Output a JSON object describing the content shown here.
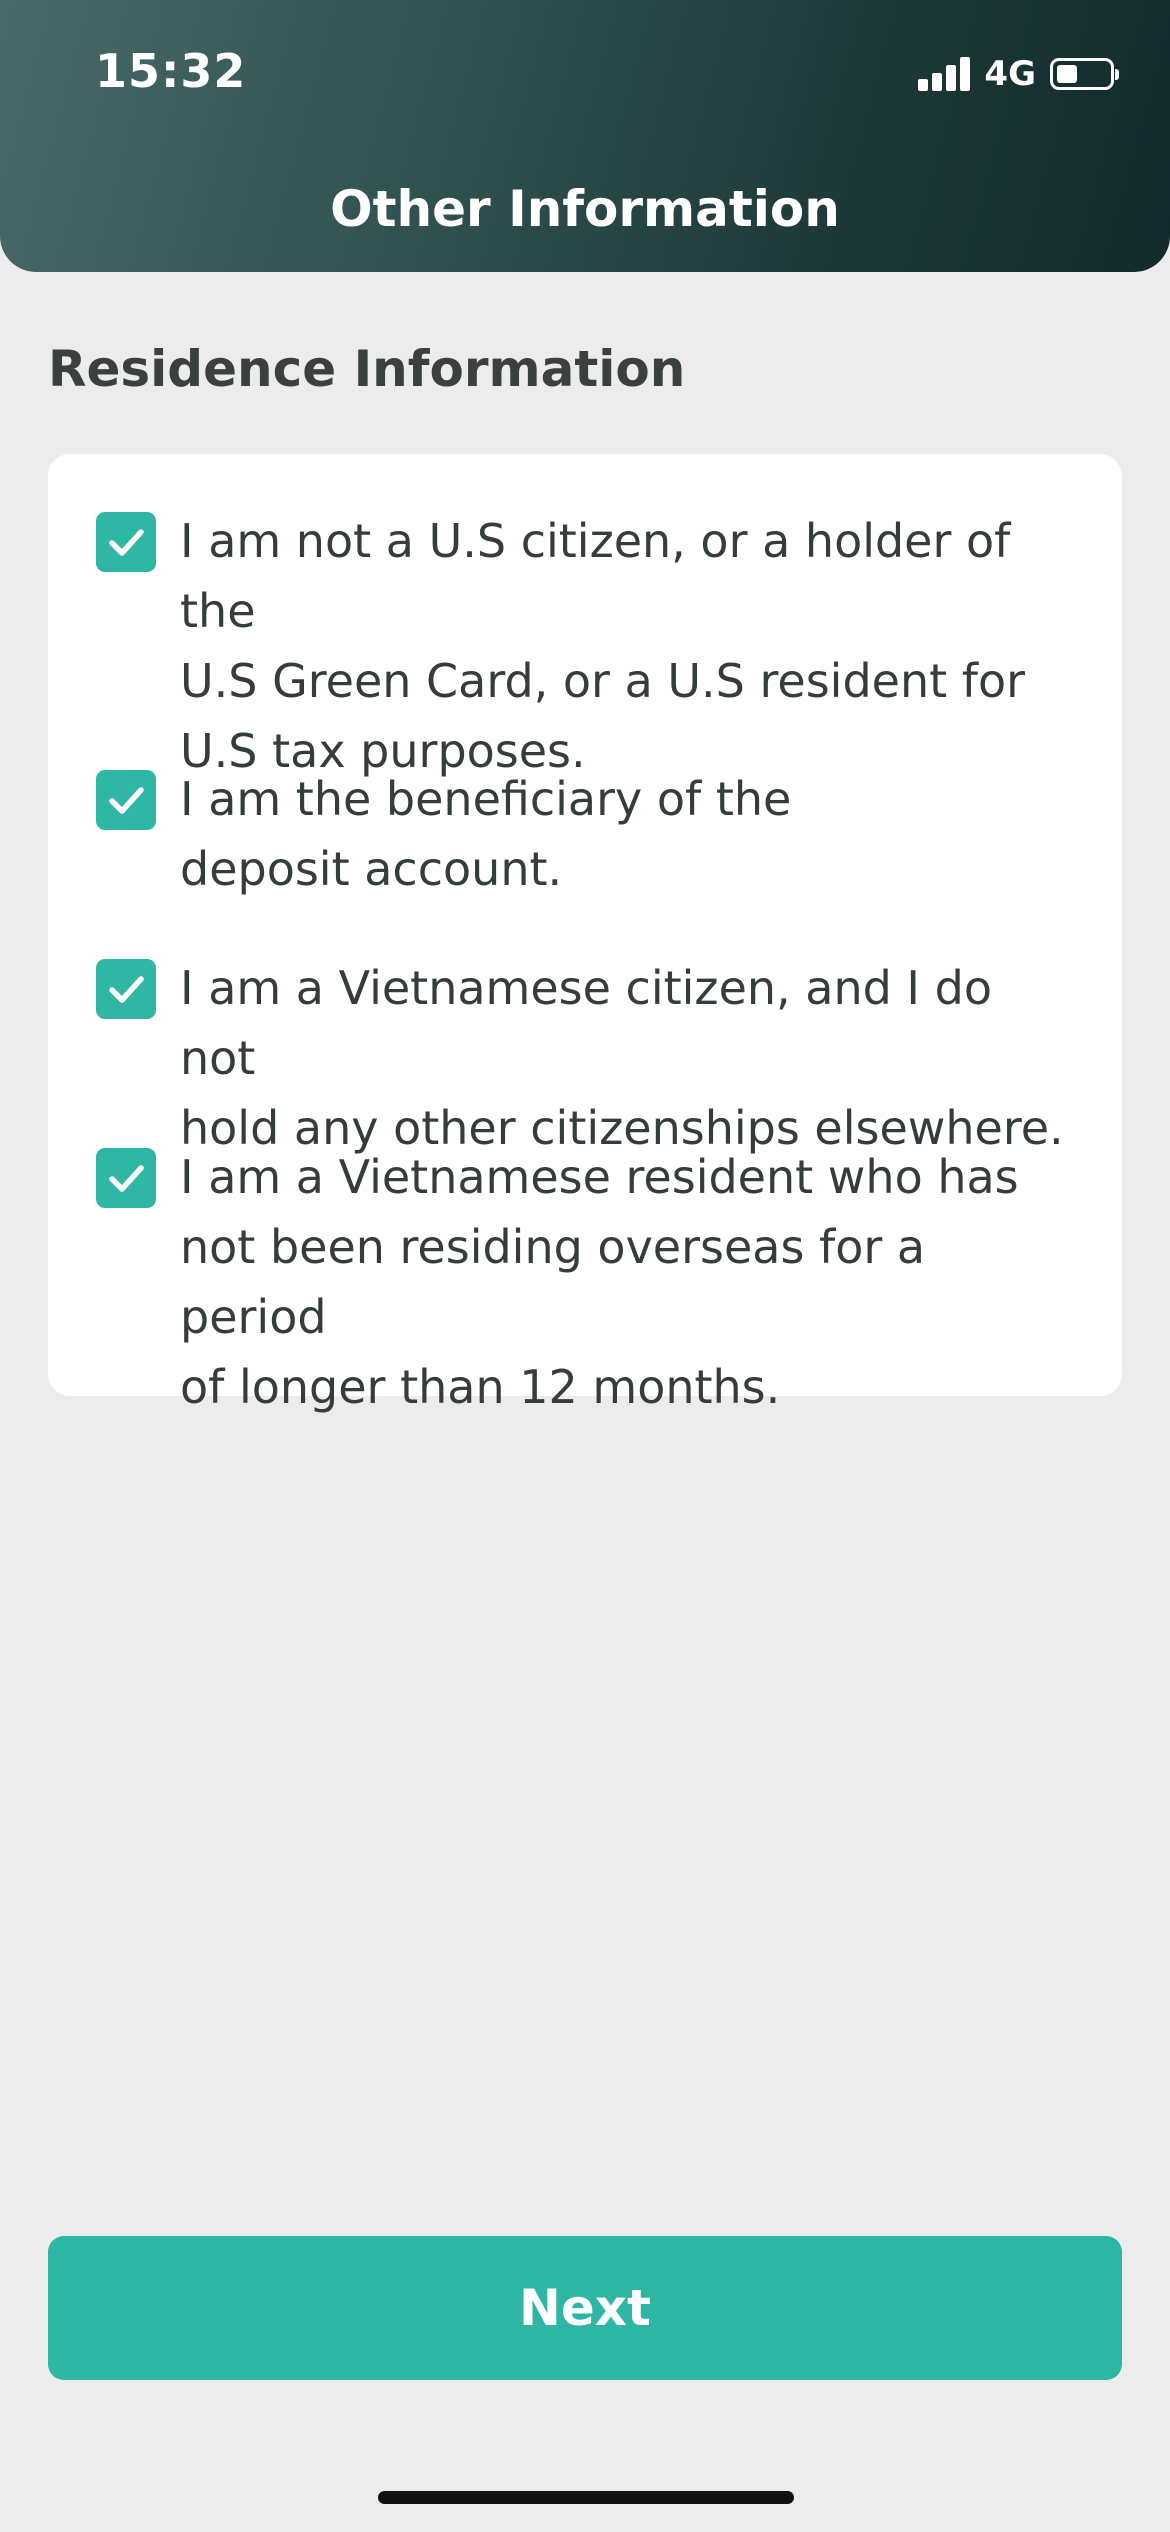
{
  "status_bar": {
    "time": "15:32",
    "network": "4G",
    "icons": [
      "signal-icon",
      "battery-icon"
    ]
  },
  "header": {
    "title": "Other Information"
  },
  "section": {
    "title": "Residence Information"
  },
  "checklist": {
    "check_color": "#2fb6a5",
    "items": [
      {
        "line1": "I am not a U.S citizen, or a holder of the",
        "line2": "U.S Green Card, or a U.S resident for",
        "line3": "U.S tax purposes.",
        "checked": true
      },
      {
        "line1": "I am the beneficiary of the",
        "line2": "deposit account.",
        "checked": true
      },
      {
        "line1": "I am a Vietnamese citizen, and I do not",
        "line2": "hold any other citizenships elsewhere.",
        "checked": true
      },
      {
        "line1": "I am a Vietnamese resident who has",
        "line2": "not been residing overseas for a period",
        "line3": "of longer than 12 months.",
        "checked": true
      }
    ]
  },
  "footer": {
    "next_label": "Next",
    "button_color": "#2cb6a3"
  },
  "colors": {
    "header_gradient_start": "#4a6a6a",
    "header_gradient_end": "#122a2b",
    "background": "#ececec"
  }
}
